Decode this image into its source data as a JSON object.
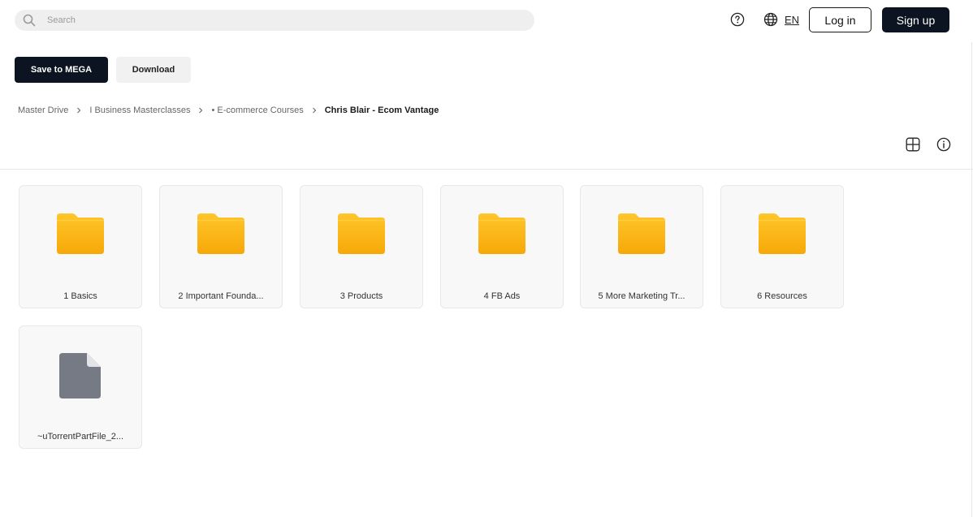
{
  "header": {
    "search_placeholder": "Search",
    "language": "EN",
    "login_label": "Log in",
    "signup_label": "Sign up"
  },
  "actions": {
    "save_label": "Save to MEGA",
    "download_label": "Download"
  },
  "breadcrumb": [
    {
      "label": "Master Drive"
    },
    {
      "label": "I Business Masterclasses"
    },
    {
      "label": "• E-commerce Courses"
    },
    {
      "label": "Chris Blair - Ecom Vantage"
    }
  ],
  "items": [
    {
      "name": "1 Basics",
      "type": "folder"
    },
    {
      "name": "2 Important Founda...",
      "type": "folder"
    },
    {
      "name": "3 Products",
      "type": "folder"
    },
    {
      "name": "4 FB Ads",
      "type": "folder"
    },
    {
      "name": "5 More Marketing Tr...",
      "type": "folder"
    },
    {
      "name": "6 Resources",
      "type": "folder"
    },
    {
      "name": "~uTorrentPartFile_2...",
      "type": "file"
    }
  ],
  "icons": {
    "search": "search-icon",
    "help": "help-circle-icon",
    "language": "globe-icon",
    "chevron": "chevron-right-icon",
    "view": "grid-view-icon",
    "info": "info-icon",
    "folder": "folder-icon",
    "file": "file-icon"
  },
  "colors": {
    "primary_dark": "#0b1420",
    "folder_top": "#ffc62b",
    "folder_bottom": "#f7a808",
    "file_gray": "#767a84"
  }
}
